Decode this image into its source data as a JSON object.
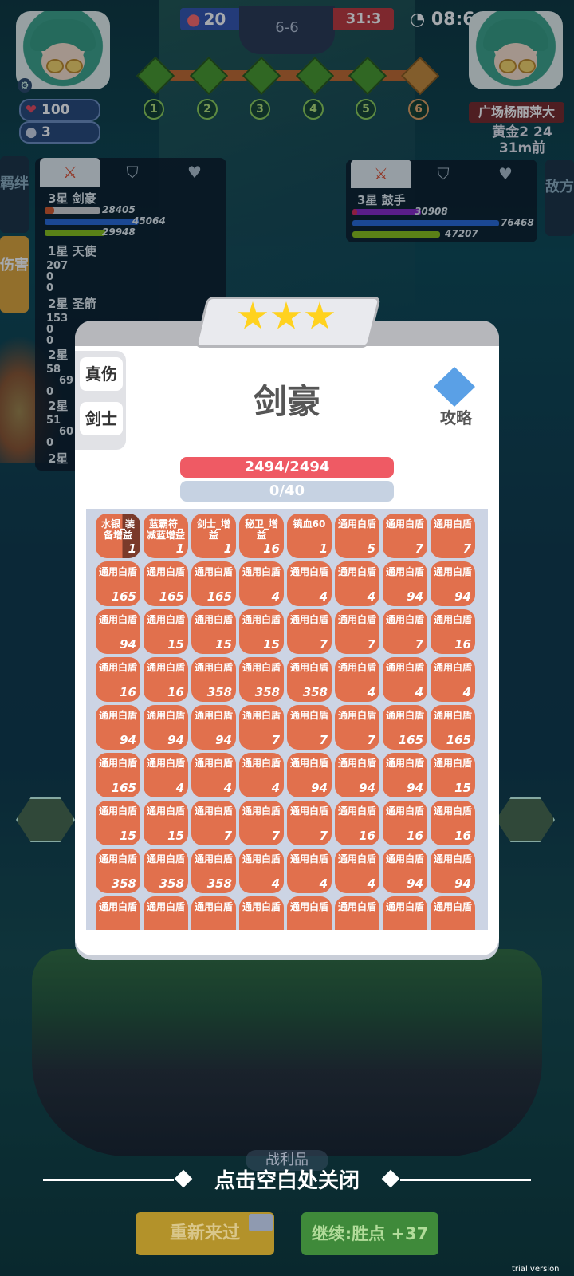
{
  "hud": {
    "player_hp": "100",
    "player_coins": "3",
    "score_blue": "20",
    "round": "6-6",
    "score_red": "31:3",
    "timer": "08:6",
    "stage_nodes": [
      "1",
      "2",
      "3",
      "4",
      "5",
      "6"
    ],
    "opponent_name": "广场杨丽萍大",
    "opponent_rank": "黄金2 24",
    "opponent_time": "31m前"
  },
  "left_side_tabs": [
    "羁绊",
    "伤害"
  ],
  "right_side_tab": "敌方",
  "left_panel": {
    "units": [
      {
        "name": "3星 剑豪",
        "vals": [
          "28405",
          "45064",
          "29948"
        ]
      },
      {
        "name": "1星 天使",
        "vals": [
          "207",
          "0",
          "0"
        ]
      },
      {
        "name": "2星 圣箭",
        "vals": [
          "153",
          "0",
          "0"
        ]
      },
      {
        "name": "2星",
        "vals": [
          "58",
          "69",
          "0"
        ]
      },
      {
        "name": "2星",
        "vals": [
          "51",
          "60",
          "0"
        ]
      },
      {
        "name": "2星",
        "vals": []
      }
    ]
  },
  "right_panel": {
    "units": [
      {
        "name": "3星 鼓手",
        "vals": [
          "30908",
          "76468",
          "47207"
        ]
      }
    ]
  },
  "modal": {
    "stars": 3,
    "tags": [
      "真伤",
      "剑士"
    ],
    "title": "剑豪",
    "guide_label": "攻略",
    "hp": "2494/2494",
    "mp": "0/40",
    "items": [
      {
        "name": "水银_装备增益",
        "count": "1"
      },
      {
        "name": "蓝霸符_减蓝增益",
        "count": "1"
      },
      {
        "name": "剑士_增益",
        "count": "1"
      },
      {
        "name": "秘卫_增益",
        "count": "16"
      },
      {
        "name": "镜血60",
        "count": "1"
      },
      {
        "name": "通用白盾",
        "count": "5"
      },
      {
        "name": "通用白盾",
        "count": "7"
      },
      {
        "name": "通用白盾",
        "count": "7"
      },
      {
        "name": "通用白盾",
        "count": "165"
      },
      {
        "name": "通用白盾",
        "count": "165"
      },
      {
        "name": "通用白盾",
        "count": "165"
      },
      {
        "name": "通用白盾",
        "count": "4"
      },
      {
        "name": "通用白盾",
        "count": "4"
      },
      {
        "name": "通用白盾",
        "count": "4"
      },
      {
        "name": "通用白盾",
        "count": "94"
      },
      {
        "name": "通用白盾",
        "count": "94"
      },
      {
        "name": "通用白盾",
        "count": "94"
      },
      {
        "name": "通用白盾",
        "count": "15"
      },
      {
        "name": "通用白盾",
        "count": "15"
      },
      {
        "name": "通用白盾",
        "count": "15"
      },
      {
        "name": "通用白盾",
        "count": "7"
      },
      {
        "name": "通用白盾",
        "count": "7"
      },
      {
        "name": "通用白盾",
        "count": "7"
      },
      {
        "name": "通用白盾",
        "count": "16"
      },
      {
        "name": "通用白盾",
        "count": "16"
      },
      {
        "name": "通用白盾",
        "count": "16"
      },
      {
        "name": "通用白盾",
        "count": "358"
      },
      {
        "name": "通用白盾",
        "count": "358"
      },
      {
        "name": "通用白盾",
        "count": "358"
      },
      {
        "name": "通用白盾",
        "count": "4"
      },
      {
        "name": "通用白盾",
        "count": "4"
      },
      {
        "name": "通用白盾",
        "count": "4"
      },
      {
        "name": "通用白盾",
        "count": "94"
      },
      {
        "name": "通用白盾",
        "count": "94"
      },
      {
        "name": "通用白盾",
        "count": "94"
      },
      {
        "name": "通用白盾",
        "count": "7"
      },
      {
        "name": "通用白盾",
        "count": "7"
      },
      {
        "name": "通用白盾",
        "count": "7"
      },
      {
        "name": "通用白盾",
        "count": "165"
      },
      {
        "name": "通用白盾",
        "count": "165"
      },
      {
        "name": "通用白盾",
        "count": "165"
      },
      {
        "name": "通用白盾",
        "count": "4"
      },
      {
        "name": "通用白盾",
        "count": "4"
      },
      {
        "name": "通用白盾",
        "count": "4"
      },
      {
        "name": "通用白盾",
        "count": "94"
      },
      {
        "name": "通用白盾",
        "count": "94"
      },
      {
        "name": "通用白盾",
        "count": "94"
      },
      {
        "name": "通用白盾",
        "count": "15"
      },
      {
        "name": "通用白盾",
        "count": "15"
      },
      {
        "name": "通用白盾",
        "count": "15"
      },
      {
        "name": "通用白盾",
        "count": "7"
      },
      {
        "name": "通用白盾",
        "count": "7"
      },
      {
        "name": "通用白盾",
        "count": "7"
      },
      {
        "name": "通用白盾",
        "count": "16"
      },
      {
        "name": "通用白盾",
        "count": "16"
      },
      {
        "name": "通用白盾",
        "count": "16"
      },
      {
        "name": "通用白盾",
        "count": "358"
      },
      {
        "name": "通用白盾",
        "count": "358"
      },
      {
        "name": "通用白盾",
        "count": "358"
      },
      {
        "name": "通用白盾",
        "count": "4"
      },
      {
        "name": "通用白盾",
        "count": "4"
      },
      {
        "name": "通用白盾",
        "count": "4"
      },
      {
        "name": "通用白盾",
        "count": "94"
      },
      {
        "name": "通用白盾",
        "count": "94"
      },
      {
        "name": "通用白盾",
        "count": ""
      },
      {
        "name": "通用白盾",
        "count": ""
      },
      {
        "name": "通用白盾",
        "count": ""
      },
      {
        "name": "通用白盾",
        "count": ""
      },
      {
        "name": "通用白盾",
        "count": ""
      },
      {
        "name": "通用白盾",
        "count": ""
      },
      {
        "name": "通用白盾",
        "count": ""
      },
      {
        "name": "通用白盾",
        "count": ""
      }
    ]
  },
  "bottom": {
    "close_hint": "点击空白处关闭",
    "spoils": "战利品",
    "retry_label": "重新来过",
    "continue_label": "继续:胜点 +37",
    "trial": "trial version"
  },
  "colors": {
    "item_cell": "#e1704d",
    "hp_bar": "#ef5a64",
    "star": "#ffd21f"
  }
}
